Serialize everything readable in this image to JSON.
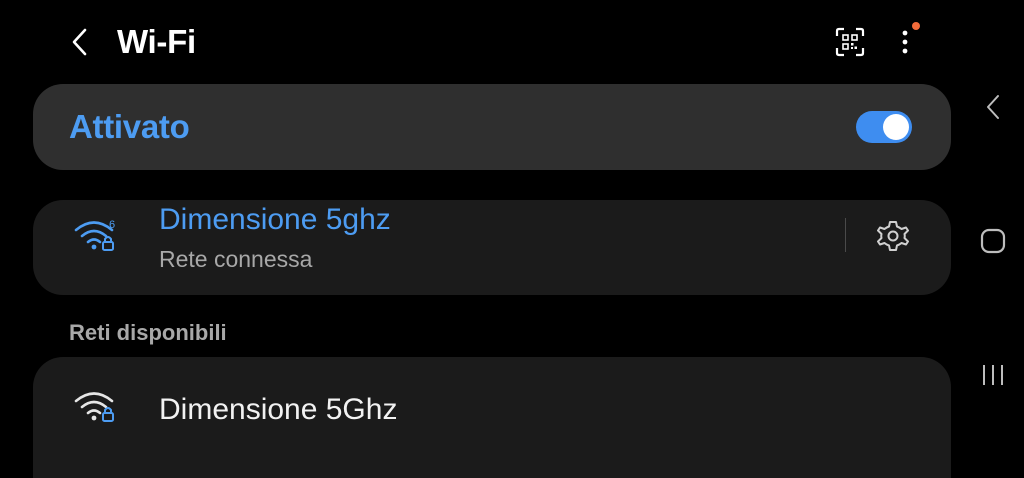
{
  "header": {
    "title": "Wi-Fi",
    "back_icon": "chevron-left-icon",
    "qr_icon": "qr-code-scan-icon",
    "more_icon": "more-vertical-icon",
    "notification_dot_color": "#f26b3a"
  },
  "master_switch": {
    "label": "Attivato",
    "enabled": true,
    "accent_color": "#4d9cf2"
  },
  "connected_network": {
    "name": "Dimensione 5ghz",
    "status": "Rete connessa",
    "icon": "wifi-6-locked-icon",
    "settings_icon": "gear-icon"
  },
  "available_section": {
    "title": "Reti disponibili",
    "networks": [
      {
        "name": "Dimensione 5Ghz",
        "icon": "wifi-locked-icon"
      }
    ]
  },
  "navbar": {
    "back_icon": "nav-back-icon",
    "home_icon": "nav-home-icon",
    "recents_icon": "nav-recents-icon"
  }
}
